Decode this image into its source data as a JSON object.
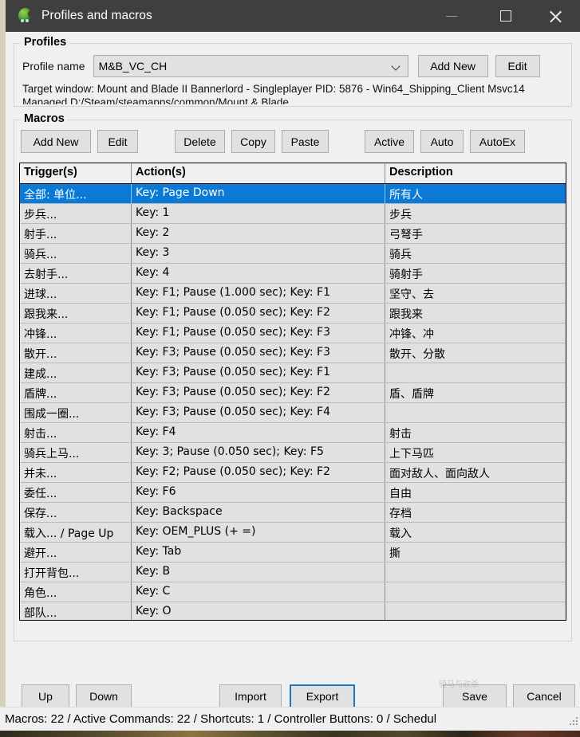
{
  "window": {
    "title": "Profiles and macros",
    "icon": "app-blob-icon",
    "minimize_label": "—",
    "maximize_label": "□",
    "close_label": "✕"
  },
  "profiles": {
    "group_title": "Profiles",
    "profile_name_label": "Profile name",
    "profile_name_value": "M&B_VC_CH",
    "profile_name_placeholder": "M&B_VC_CH",
    "add_new_label": "Add New",
    "edit_label": "Edit",
    "target_window_text": "Target window: Mount and Blade II Bannerlord - Singleplayer PID: 5876 - Win64_Shipping_Client Msvc14 Managed D:/Steam/steamapps/common/Mount & Blade"
  },
  "macros": {
    "group_title": "Macros",
    "toolbar": {
      "add_new": "Add New",
      "edit": "Edit",
      "delete": "Delete",
      "copy": "Copy",
      "paste": "Paste",
      "active": "Active",
      "auto": "Auto",
      "autoex": "AutoEx"
    },
    "columns": [
      "Trigger(s)",
      "Action(s)",
      "Description"
    ],
    "selected_row_index": 0,
    "selection_color": "#0a7ad6",
    "rows": [
      {
        "trigger": "全部: 单位...",
        "action": "Key: Page Down",
        "description": "所有人"
      },
      {
        "trigger": "步兵...",
        "action": "Key: 1",
        "description": "步兵"
      },
      {
        "trigger": "射手...",
        "action": "Key: 2",
        "description": "弓弩手"
      },
      {
        "trigger": "骑兵...",
        "action": "Key: 3",
        "description": "骑兵"
      },
      {
        "trigger": "去射手...",
        "action": "Key: 4",
        "description": "骑射手"
      },
      {
        "trigger": "进球...",
        "action": "Key: F1; Pause (1.000 sec); Key: F1",
        "description": "坚守、去"
      },
      {
        "trigger": "跟我来...",
        "action": "Key: F1; Pause (0.050 sec); Key: F2",
        "description": "跟我来"
      },
      {
        "trigger": "冲锋...",
        "action": "Key: F1; Pause (0.050 sec); Key: F3",
        "description": "冲锋、冲"
      },
      {
        "trigger": "散开...",
        "action": "Key: F3; Pause (0.050 sec); Key: F3",
        "description": "散开、分散"
      },
      {
        "trigger": "建成...",
        "action": "Key: F3; Pause (0.050 sec); Key: F1",
        "description": ""
      },
      {
        "trigger": "盾牌...",
        "action": "Key: F3; Pause (0.050 sec); Key: F2",
        "description": "盾、盾牌"
      },
      {
        "trigger": "围成一圈...",
        "action": "Key: F3; Pause (0.050 sec); Key: F4",
        "description": ""
      },
      {
        "trigger": "射击...",
        "action": "Key: F4",
        "description": "射击"
      },
      {
        "trigger": "骑兵上马...",
        "action": "Key: 3; Pause (0.050 sec); Key: F5",
        "description": "上下马匹"
      },
      {
        "trigger": "并未...",
        "action": "Key: F2; Pause (0.050 sec); Key: F2",
        "description": "面对敌人、面向敌人"
      },
      {
        "trigger": "委任...",
        "action": "Key: F6",
        "description": "自由"
      },
      {
        "trigger": "保存...",
        "action": "Key: Backspace",
        "description": "存档"
      },
      {
        "trigger": "载入... / Page Up",
        "action": "Key: OEM_PLUS (+ =)",
        "description": "载入"
      },
      {
        "trigger": "避开...",
        "action": "Key: Tab",
        "description": "撕"
      },
      {
        "trigger": "打开背包...",
        "action": "Key: B",
        "description": ""
      },
      {
        "trigger": "角色...",
        "action": "Key: C",
        "description": ""
      },
      {
        "trigger": "部队...",
        "action": "Key: O",
        "description": ""
      }
    ]
  },
  "bottom_toolbar": {
    "up": "Up",
    "down": "Down",
    "import": "Import",
    "export": "Export",
    "save": "Save",
    "cancel": "Cancel",
    "focused_button": "Export",
    "focus_color": "#1a78c2"
  },
  "statusbar": {
    "text": "Macros: 22 / Active Commands: 22 / Shortcuts: 1 / Controller Buttons: 0 / Schedul"
  }
}
